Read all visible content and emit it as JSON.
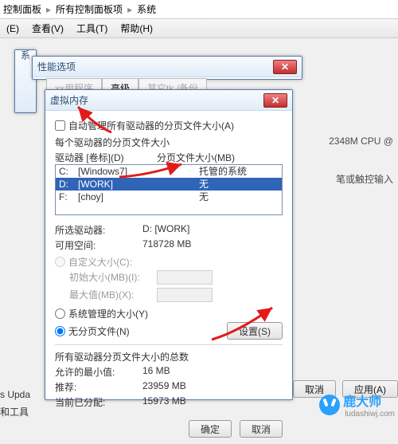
{
  "breadcrumb": {
    "a": "控制面板",
    "b": "所有控制面板项",
    "c": "系统",
    "sep": "▸"
  },
  "menu": {
    "edit": "(E)",
    "view": "查看(V)",
    "tools": "工具(T)",
    "help": "帮助(H)"
  },
  "sys_window_title": "系",
  "perf_window_title": "性能选项",
  "tabs": {
    "t1": "xx用程序",
    "t2": "高级",
    "t3": "其它tk /备份"
  },
  "vm": {
    "title": "虚拟内存",
    "auto_label": "自动管理所有驱动器的分页文件大小(A)",
    "paging_each": "每个驱动器的分页文件大小",
    "col_drive": "驱动器 [卷标](D)",
    "col_size": "分页文件大小(MB)",
    "drives": [
      {
        "letter": "C:",
        "vol": "[Windows7]",
        "size": "托管的系统"
      },
      {
        "letter": "D:",
        "vol": "[WORK]",
        "size": "无"
      },
      {
        "letter": "F:",
        "vol": "[choy]",
        "size": "无"
      }
    ],
    "selected_index": 1,
    "sel_drive_k": "所选驱动器:",
    "sel_drive_v": "D:  [WORK]",
    "avail_k": "可用空间:",
    "avail_v": "718728 MB",
    "custom_label": "自定义大小(C):",
    "init_k": "初始大小(MB)(I):",
    "max_k": "最大值(MB)(X):",
    "sys_managed": "系统管理的大小(Y)",
    "no_paging": "无分页文件(N)",
    "set_btn": "设置(S)",
    "totals_title": "所有驱动器分页文件大小的总数",
    "min_k": "允许的最小值:",
    "min_v": "16 MB",
    "rec_k": "推荐:",
    "rec_v": "23959 MB",
    "cur_k": "当前已分配:",
    "cur_v": "15973 MB",
    "ok": "确定",
    "cancel": "取消"
  },
  "bg": {
    "cpu": "2348M CPU @",
    "pen": "笔或触控输入",
    "upd": "s Upda",
    "tool": "和工具",
    "ok2": "确定",
    "cancel2": "取消",
    "apply": "应用(A)"
  },
  "watermark": {
    "name": "鹿大师",
    "url": "ludashiwj.com"
  }
}
